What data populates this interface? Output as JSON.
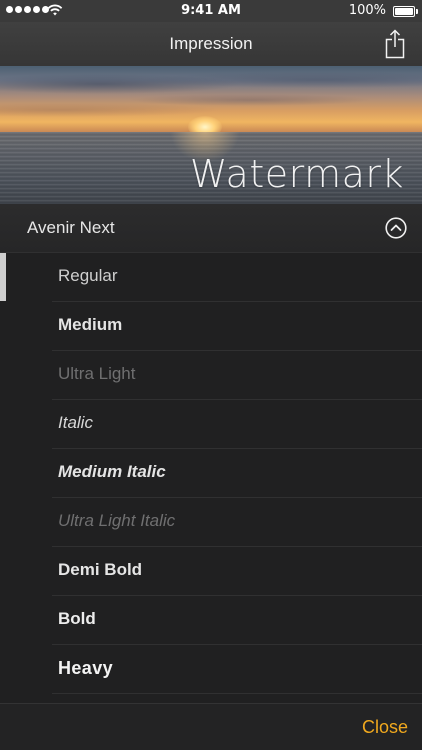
{
  "status_bar": {
    "time": "9:41 AM",
    "battery": "100%"
  },
  "nav": {
    "title": "Impression",
    "share_icon": "share-icon"
  },
  "preview": {
    "watermark_text": "Watermark"
  },
  "font_family": {
    "name": "Avenir Next",
    "toggle_icon": "chevron-up-circle-icon"
  },
  "styles": [
    {
      "label": "Regular",
      "selected": true
    },
    {
      "label": "Medium"
    },
    {
      "label": "Ultra Light"
    },
    {
      "label": "Italic"
    },
    {
      "label": "Medium Italic"
    },
    {
      "label": "Ultra Light Italic"
    },
    {
      "label": "Demi Bold"
    },
    {
      "label": "Bold"
    },
    {
      "label": "Heavy"
    }
  ],
  "footer": {
    "close_label": "Close"
  },
  "colors": {
    "accent": "#f0a81e",
    "background": "#202021"
  }
}
